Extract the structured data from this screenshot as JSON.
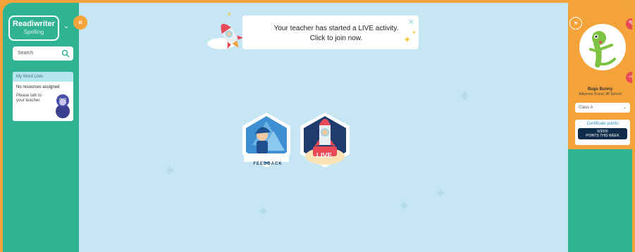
{
  "app": {
    "logo_title": "Readiwriter",
    "logo_subtitle": "Spelling"
  },
  "sidebar_left": {
    "search_placeholder": "Search",
    "word_lists": {
      "header": "My Word Lists",
      "empty_title": "No resources assigned",
      "empty_hint": "Please talk to your teacher."
    }
  },
  "notification": {
    "line1": "Your teacher has started a LIVE activity.",
    "line2": "Click to join now."
  },
  "activities": [
    {
      "label": "FEEDBACK"
    },
    {
      "label": "LIVE"
    }
  ],
  "profile": {
    "name": "Bugs Bunny",
    "school": "Allsymes Scenic 3P School",
    "class_selected": "Class A",
    "certificate_label": "Certificate points",
    "certificate_value": "0/3000",
    "certificate_sub": "POINTS THIS WEEK"
  },
  "colors": {
    "accent_orange": "#f4a23a",
    "sidebar_green": "#2fb392",
    "canvas_blue": "#c6e6f3",
    "badge_red": "#e94a58"
  }
}
